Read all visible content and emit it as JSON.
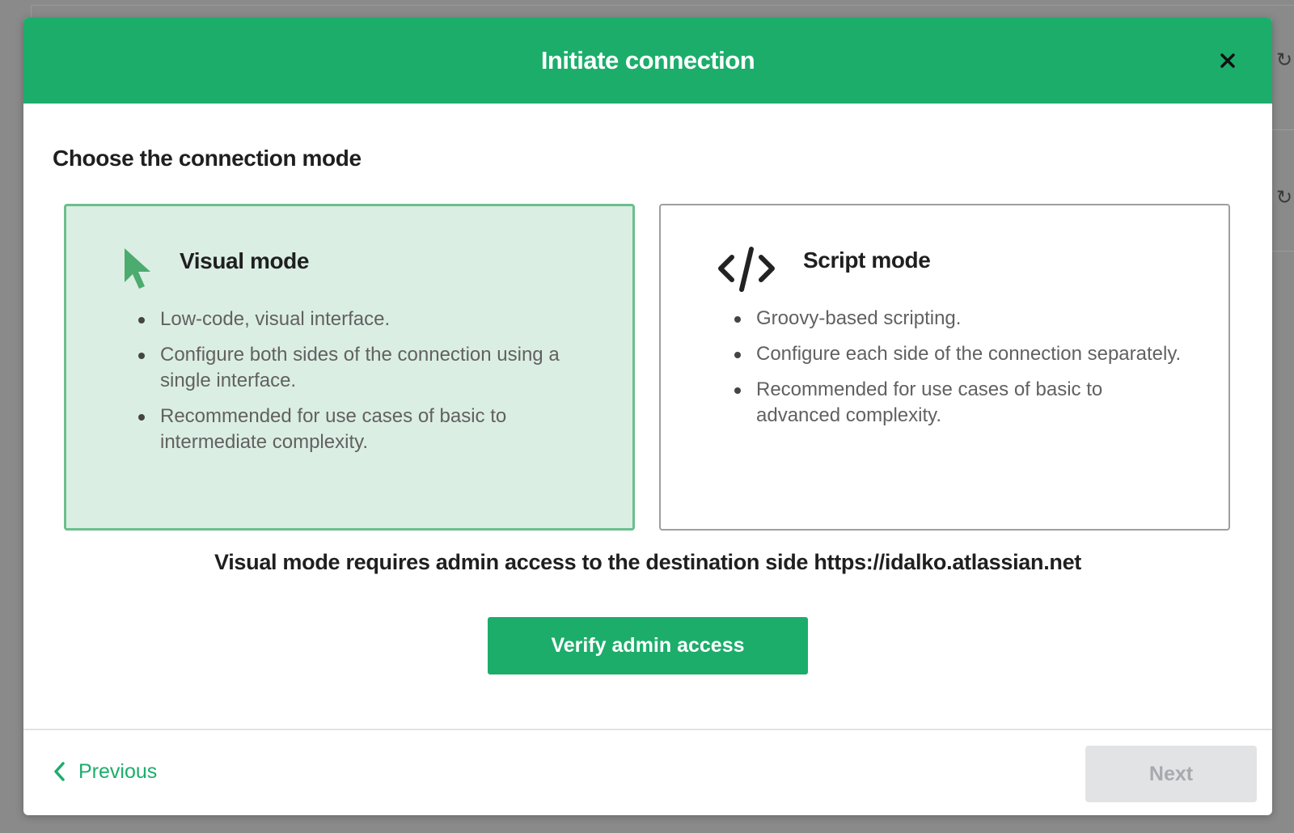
{
  "modal": {
    "title": "Initiate connection",
    "section_title": "Choose the connection mode",
    "accent_color": "#1cad6b"
  },
  "modes": [
    {
      "title": "Visual mode",
      "icon": "cursor-arrow-icon",
      "selected": true,
      "bullets": [
        "Low-code, visual interface.",
        "Configure both sides of the connection using a single interface.",
        "Recommended for use cases of basic to intermediate complexity."
      ]
    },
    {
      "title": "Script mode",
      "icon": "code-brackets-icon",
      "selected": false,
      "bullets": [
        "Groovy-based scripting.",
        "Configure each side of the connection separately.",
        "Recommended for use cases of basic to advanced complexity."
      ]
    }
  ],
  "notice": "Visual mode requires admin access to the destination side https://idalko.atlassian.net",
  "buttons": {
    "verify": "Verify admin access",
    "previous": "Previous",
    "next": "Next"
  }
}
